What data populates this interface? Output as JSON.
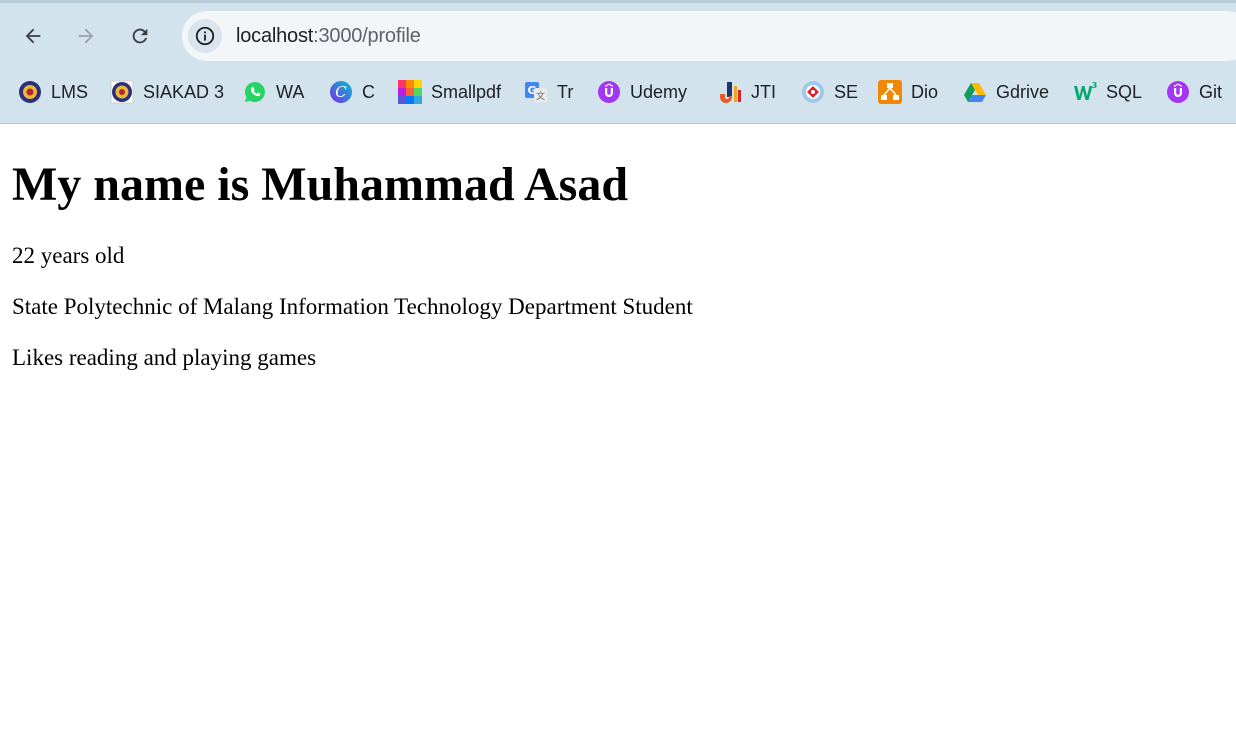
{
  "browser": {
    "nav": {
      "back_icon": "arrow-left-icon",
      "forward_icon": "arrow-right-icon",
      "reload_icon": "reload-icon"
    },
    "address_bar": {
      "site_info_icon": "info-icon",
      "url_host": "localhost",
      "url_path": ":3000/profile"
    },
    "bookmarks": [
      {
        "label": "LMS",
        "icon": "polinema-crest-icon"
      },
      {
        "label": "SIAKAD 3",
        "icon": "polinema-crest-icon"
      },
      {
        "label": "WA",
        "icon": "whatsapp-icon"
      },
      {
        "label": "C",
        "icon": "canva-icon"
      },
      {
        "label": "Smallpdf",
        "icon": "smallpdf-icon"
      },
      {
        "label": "Tr",
        "icon": "google-translate-icon"
      },
      {
        "label": "Udemy",
        "icon": "udemy-icon"
      },
      {
        "label": "JTI",
        "icon": "jti-icon"
      },
      {
        "label": "SE",
        "icon": "se-icon"
      },
      {
        "label": "Dio",
        "icon": "diagrams-icon"
      },
      {
        "label": "Gdrive",
        "icon": "google-drive-icon"
      },
      {
        "label": "SQL",
        "icon": "w3schools-icon"
      },
      {
        "label": "Git",
        "icon": "udemy-icon"
      }
    ]
  },
  "page": {
    "heading": "My name is Muhammad Asad",
    "age": "22 years old",
    "school": "State Polytechnic of Malang Information Technology Department Student",
    "hobby": "Likes reading and playing games"
  },
  "colors": {
    "toolbar_bg": "#d3e3ee",
    "omnibox_bg": "#f3f6f8",
    "text": "#202124",
    "url_path": "#5f6368"
  }
}
